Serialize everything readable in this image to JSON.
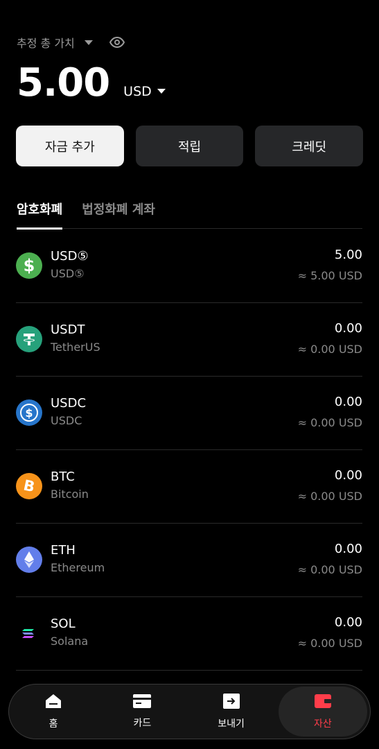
{
  "header": {
    "value_label": "추정 총 가치",
    "amount": "5.00",
    "currency": "USD"
  },
  "actions": {
    "add_funds": "자금 추가",
    "earn": "적립",
    "credit": "크레딧"
  },
  "tabs": [
    {
      "label": "암호화폐",
      "active": true
    },
    {
      "label": "법정화폐 계좌",
      "active": false
    }
  ],
  "assets": [
    {
      "symbol": "USD⑤",
      "name": "USD⑤",
      "amount": "5.00",
      "approx": "≈ 5.00 USD",
      "icon": "usd-dollar-icon",
      "color": "#4caf50"
    },
    {
      "symbol": "USDT",
      "name": "TetherUS",
      "amount": "0.00",
      "approx": "≈ 0.00 USD",
      "icon": "tether-icon",
      "color": "#26a17b"
    },
    {
      "symbol": "USDC",
      "name": "USDC",
      "amount": "0.00",
      "approx": "≈ 0.00 USD",
      "icon": "usdc-icon",
      "color": "#2775ca"
    },
    {
      "symbol": "BTC",
      "name": "Bitcoin",
      "amount": "0.00",
      "approx": "≈ 0.00 USD",
      "icon": "bitcoin-icon",
      "color": "#f7931a"
    },
    {
      "symbol": "ETH",
      "name": "Ethereum",
      "amount": "0.00",
      "approx": "≈ 0.00 USD",
      "icon": "ethereum-icon",
      "color": "#627eea"
    },
    {
      "symbol": "SOL",
      "name": "Solana",
      "amount": "0.00",
      "approx": "≈ 0.00 USD",
      "icon": "solana-icon",
      "color": "#000000"
    }
  ],
  "nav": [
    {
      "label": "홈",
      "icon": "home-icon",
      "active": false
    },
    {
      "label": "카드",
      "icon": "card-icon",
      "active": false
    },
    {
      "label": "보내기",
      "icon": "send-icon",
      "active": false
    },
    {
      "label": "자산",
      "icon": "wallet-icon",
      "active": true
    }
  ]
}
